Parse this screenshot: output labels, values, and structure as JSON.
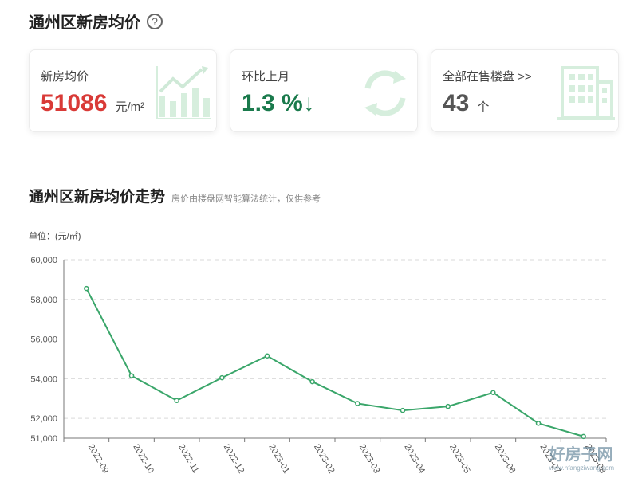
{
  "header": {
    "title": "通州区新房均价",
    "help_icon": "question-circle-icon"
  },
  "cards": [
    {
      "label": "新房均价",
      "value": "51086",
      "unit": "元/m²",
      "icon": "chart-trend-up-icon",
      "color": "#d93a37"
    },
    {
      "label": "环比上月",
      "value": "1.3 %↓",
      "unit": "",
      "icon": "refresh-cycle-icon",
      "color": "#1a7a4c"
    },
    {
      "label": "全部在售楼盘 >>",
      "value": "43",
      "unit": "个",
      "icon": "building-icon",
      "color": "#555555"
    }
  ],
  "section": {
    "title": "通州区新房均价走势",
    "note": "房价由楼盘网智能算法统计，仅供参考"
  },
  "unit_label": "单位：(元/㎡)",
  "watermark": {
    "text": "好房子网",
    "url": "www.hfangziwang.com"
  },
  "chart_data": {
    "type": "line",
    "categories": [
      "2022-09",
      "2022-10",
      "2022-11",
      "2022-12",
      "2023-01",
      "2023-02",
      "2023-03",
      "2023-04",
      "2023-05",
      "2023-06",
      "2023-07",
      "2023-08"
    ],
    "values": [
      58550,
      54150,
      52900,
      54050,
      55150,
      53850,
      52750,
      52400,
      52600,
      53300,
      51750,
      51086
    ],
    "ylim": [
      51000,
      60000
    ],
    "yticks": [
      51000,
      52000,
      54000,
      56000,
      58000,
      60000
    ],
    "ytick_labels": [
      "51,000",
      "52,000",
      "54,000",
      "56,000",
      "58,000",
      "60,000"
    ],
    "line_color": "#3aa66a",
    "grid": true
  }
}
